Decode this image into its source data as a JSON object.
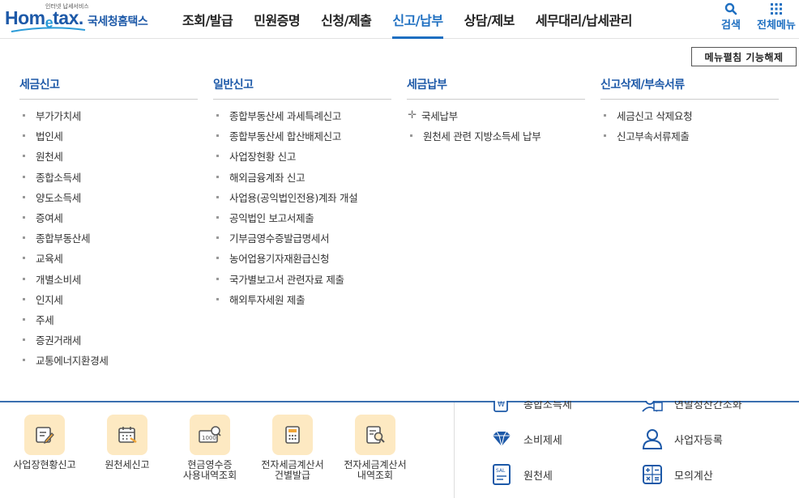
{
  "logo": {
    "small": "인터넷 납세서비스",
    "home_a": "Hom",
    "home_e": "e",
    "home_b": "tax.",
    "korean": "국세청홈택스"
  },
  "nav": [
    "조회/발급",
    "민원증명",
    "신청/제출",
    "신고/납부",
    "상담/제보",
    "세무대리/납세관리"
  ],
  "nav_active_index": 3,
  "utility": {
    "search": "검색",
    "all_menu": "전체메뉴"
  },
  "mega_menu": {
    "unpin_button": "메뉴펼침 기능해제",
    "columns": [
      {
        "title": "세금신고",
        "items": [
          "부가가치세",
          "법인세",
          "원천세",
          "종합소득세",
          "양도소득세",
          "증여세",
          "종합부동산세",
          "교육세",
          "개별소비세",
          "인지세",
          "주세",
          "증권거래세",
          "교통에너지환경세"
        ]
      },
      {
        "title": "일반신고",
        "items": [
          "종합부동산세 과세특례신고",
          "종합부동산세 합산배제신고",
          "사업장현황 신고",
          "해외금융계좌 신고",
          "사업용(공익법인전용)계좌 개설",
          "공익법인 보고서제출",
          "기부금영수증발급명세서",
          "농어업용기자재환급신청",
          "국가별보고서 관련자료 제출",
          "해외투자세원 제출"
        ]
      },
      {
        "title": "세금납부",
        "items": [
          "국세납부",
          "원천세 관련 지방소득세 납부"
        ],
        "expandable": [
          true,
          false
        ]
      },
      {
        "title": "신고삭제/부속서류",
        "items": [
          "세금신고 삭제요청",
          "신고부속서류제출"
        ]
      }
    ]
  },
  "quick_menu": [
    {
      "label_1": "사업장현황신고",
      "label_2": "",
      "icon": "report-edit-icon"
    },
    {
      "label_1": "원천세신고",
      "label_2": "",
      "icon": "calendar-icon"
    },
    {
      "label_1": "현금영수증",
      "label_2": "사용내역조회",
      "icon": "cash-receipt-icon"
    },
    {
      "label_1": "전자세금계산서",
      "label_2": "건별발급",
      "icon": "calculator-doc-icon"
    },
    {
      "label_1": "전자세금계산서",
      "label_2": "내역조회",
      "icon": "doc-search-icon"
    }
  ],
  "services": [
    {
      "label": "종합소득세",
      "icon": "won-doc-icon"
    },
    {
      "label": "연말정산간소화",
      "icon": "won-person-icon"
    },
    {
      "label": "소비제세",
      "icon": "diamond-icon"
    },
    {
      "label": "사업자등록",
      "icon": "person-icon"
    },
    {
      "label": "원천세",
      "icon": "tax-doc-icon"
    },
    {
      "label": "모의계산",
      "icon": "calculator-icon"
    }
  ],
  "colors": {
    "brand": "#1d59a8",
    "accent": "#1e6fc1",
    "quick_bg": "#fde9c2"
  }
}
